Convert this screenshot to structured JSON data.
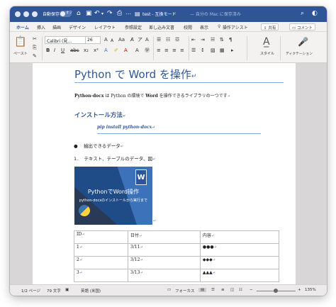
{
  "titlebar": {
    "autosave_label": "自動保存",
    "autosave_state": "オフ",
    "doc_title": "test - 互換モード",
    "save_status": "— 自分の Mac に保存済み"
  },
  "tabs": [
    "ホーム",
    "挿入",
    "描画",
    "デザイン",
    "レイアウト",
    "参照設定",
    "差し込み文書",
    "校閲",
    "表示",
    "操作アシスト"
  ],
  "share": {
    "share_label": "共有",
    "comment_label": "コメント"
  },
  "ribbon": {
    "paste_label": "ペースト",
    "font_name": "Calibri (見…",
    "font_size": "26",
    "styles_label": "スタイル",
    "dictation_label": "ディクテーション"
  },
  "document": {
    "title": "Python で Word を操作",
    "intro_parts": [
      "Python-docx",
      " は ",
      "Python",
      " の環境で ",
      "Word",
      " を操作できるライブラリの一つです"
    ],
    "heading": "インストール方法",
    "code": "pip install python-docx",
    "bullet": "抽出できるデータ",
    "numbered_index": "1.",
    "numbered_item": "テキスト、テーブルのデータ、図",
    "image_title": "PythonでWord操作",
    "image_subtitle": "python-docxのインストールから実行まで",
    "image_badge": "W",
    "table": {
      "headers": [
        "ID",
        "日付",
        "内容"
      ],
      "rows": [
        [
          "1",
          "3/11",
          "●●●"
        ],
        [
          "2",
          "3/12",
          "◆◆◆"
        ],
        [
          "3",
          "3/13",
          "▲▲▲"
        ]
      ]
    }
  },
  "status": {
    "pages": "1/2 ページ",
    "words": "79 文字",
    "language": "英語 (米国)",
    "focus": "フォーカス",
    "zoom_minus": "−",
    "zoom_plus": "+",
    "zoom": "135%"
  }
}
